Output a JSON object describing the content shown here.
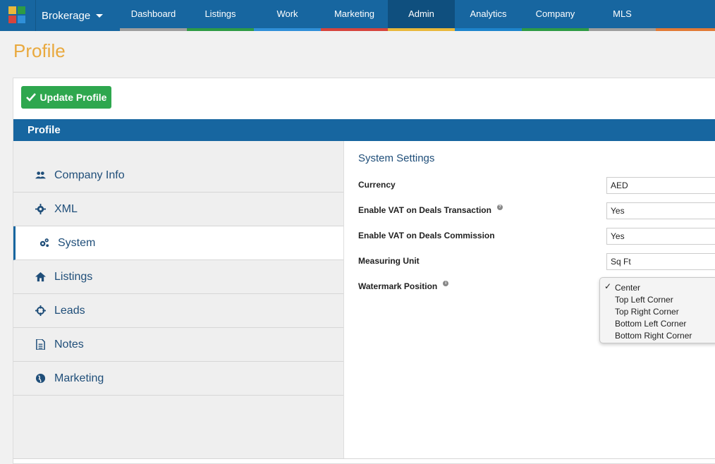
{
  "header": {
    "brand": "Brokerage",
    "tabs": [
      {
        "label": "Dashboard",
        "color": "#9e9e9e",
        "active": false
      },
      {
        "label": "Listings",
        "color": "#2e9b45",
        "active": false
      },
      {
        "label": "Work",
        "color": "#2f8fd8",
        "active": false
      },
      {
        "label": "Marketing",
        "color": "#d6443c",
        "active": false
      },
      {
        "label": "Admin",
        "color": "#e9b83a",
        "active": true
      },
      {
        "label": "Analytics",
        "color": "#1d84cc",
        "active": false
      },
      {
        "label": "Company",
        "color": "#2e9b45",
        "active": false
      },
      {
        "label": "MLS",
        "color": "#9e9e9e",
        "active": false
      },
      {
        "label": "",
        "color": "#e27a35",
        "active": false
      }
    ]
  },
  "page": {
    "title": "Profile",
    "update_button": "Update Profile",
    "section_header": "Profile"
  },
  "sidebar": {
    "items": [
      {
        "label": "Company Info",
        "icon": "users-icon",
        "active": false
      },
      {
        "label": "XML",
        "icon": "gear-icon",
        "active": false
      },
      {
        "label": "System",
        "icon": "gears-icon",
        "active": true
      },
      {
        "label": "Listings",
        "icon": "home-icon",
        "active": false
      },
      {
        "label": "Leads",
        "icon": "crosshair-icon",
        "active": false
      },
      {
        "label": "Notes",
        "icon": "document-icon",
        "active": false
      },
      {
        "label": "Marketing",
        "icon": "globe-icon",
        "active": false
      }
    ]
  },
  "settings": {
    "title": "System Settings",
    "rows": [
      {
        "label": "Currency",
        "value": "AED",
        "help": false
      },
      {
        "label": "Enable VAT on Deals Transaction",
        "value": "Yes",
        "help": true
      },
      {
        "label": "Enable VAT on Deals Commission",
        "value": "Yes",
        "help": false
      },
      {
        "label": "Measuring Unit",
        "value": "Sq Ft",
        "help": false
      },
      {
        "label": "Watermark Position",
        "value": "Center",
        "help": true
      }
    ],
    "watermark_options": [
      "Center",
      "Top Left Corner",
      "Top Right Corner",
      "Bottom Left Corner",
      "Bottom Right Corner"
    ],
    "watermark_selected": "Center",
    "check_mark": "✓"
  },
  "colors": {
    "nav_bg": "#1766a0",
    "title": "#e9a93e",
    "update_button": "#2ea74e",
    "link": "#1f4e79"
  }
}
